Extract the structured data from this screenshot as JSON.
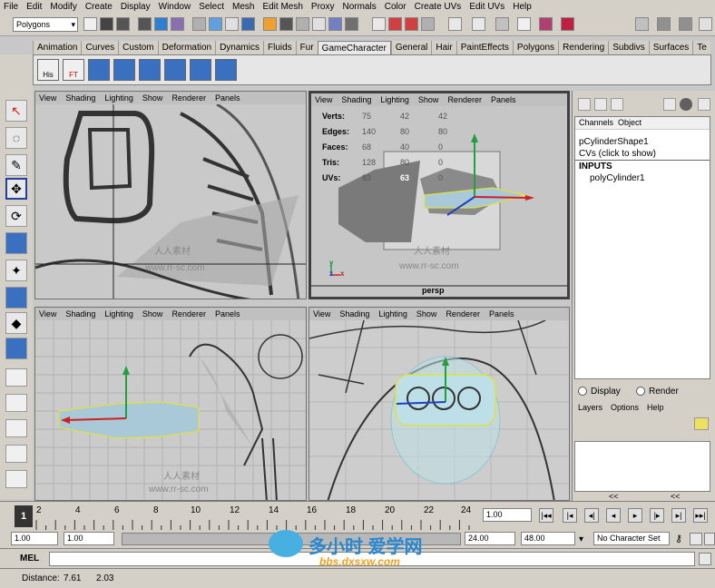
{
  "menu": [
    "File",
    "Edit",
    "Modify",
    "Create",
    "Display",
    "Window",
    "Select",
    "Mesh",
    "Edit Mesh",
    "Proxy",
    "Normals",
    "Color",
    "Create UVs",
    "Edit UVs",
    "Help"
  ],
  "mode_selector": "Polygons",
  "shelf_tabs": [
    "Animation",
    "Curves",
    "Custom",
    "Deformation",
    "Dynamics",
    "Fluids",
    "Fur",
    "GameCharacter",
    "General",
    "Hair",
    "PaintEffects",
    "Polygons",
    "Rendering",
    "Subdivs",
    "Surfaces",
    "Te"
  ],
  "shelf_active_tab": "GameCharacter",
  "shelf_icons": [
    "His",
    "FT"
  ],
  "viewport_menu": [
    "View",
    "Shading",
    "Lighting",
    "Show",
    "Renderer",
    "Panels"
  ],
  "hud": {
    "labels": [
      "Verts:",
      "Edges:",
      "Faces:",
      "Tris:",
      "UVs:"
    ],
    "col1": [
      "75",
      "140",
      "68",
      "128",
      "83"
    ],
    "col2": [
      "42",
      "80",
      "40",
      "80",
      "63"
    ],
    "col3": [
      "42",
      "80",
      "0",
      "0",
      "0"
    ]
  },
  "persp_label": "persp",
  "axis_labels": {
    "y": "y",
    "z": "z",
    "x": "x"
  },
  "channel_box": {
    "menu": [
      "Channels",
      "Object"
    ],
    "shape": "pCylinderShape1",
    "cvs": "CVs (click to show)",
    "inputs": "INPUTS",
    "input_node": "polyCylinder1"
  },
  "layer_editor": {
    "display": "Display",
    "render": "Render",
    "menu": [
      "Layers",
      "Options",
      "Help"
    ]
  },
  "timeline_ticks": [
    "2",
    "4",
    "6",
    "8",
    "10",
    "12",
    "14",
    "16",
    "18",
    "20",
    "22",
    "24"
  ],
  "current_frame": "1",
  "current_time_field": "1.00",
  "range": {
    "start": "1.00",
    "playback_start": "1.00",
    "playback_end": "24.00",
    "end": "48.00",
    "character_set": "No Character Set"
  },
  "mel_label": "MEL",
  "status_text": {
    "label": "Distance:",
    "value1": "7.61",
    "value2": "2.03"
  },
  "watermarks": {
    "rr": "www.rr-sc.com",
    "cn": "人人素材",
    "logo": "多小时 爱学网",
    "logo_url": "bbs.dxsxw.com"
  }
}
